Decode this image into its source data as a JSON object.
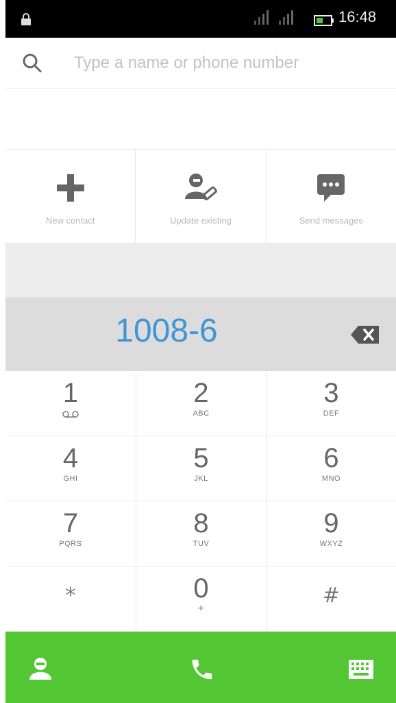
{
  "status_bar": {
    "time": "16:48",
    "icons": [
      "lock-icon",
      "signal-icon",
      "signal-icon",
      "battery-icon"
    ]
  },
  "search": {
    "placeholder": "Type a name or phone number",
    "value": ""
  },
  "actions": [
    {
      "label": "New contact",
      "icon": "plus-icon"
    },
    {
      "label": "Update existing",
      "icon": "contact-edit-icon"
    },
    {
      "label": "Send messages",
      "icon": "message-icon"
    }
  ],
  "display": {
    "number": "1008-6",
    "delete_icon": "backspace-icon"
  },
  "keypad": [
    {
      "digit": "1",
      "letters": ""
    },
    {
      "digit": "2",
      "letters": "ABC"
    },
    {
      "digit": "3",
      "letters": "DEF"
    },
    {
      "digit": "4",
      "letters": "GHI"
    },
    {
      "digit": "5",
      "letters": "JKL"
    },
    {
      "digit": "6",
      "letters": "MNO"
    },
    {
      "digit": "7",
      "letters": "PQRS"
    },
    {
      "digit": "8",
      "letters": "TUV"
    },
    {
      "digit": "9",
      "letters": "WXYZ"
    },
    {
      "digit": "*",
      "letters": ""
    },
    {
      "digit": "0",
      "letters": "+"
    },
    {
      "digit": "#",
      "letters": ""
    }
  ],
  "bottom_bar": {
    "icons": [
      "contacts-icon",
      "call-icon",
      "keyboard-icon"
    ]
  },
  "colors": {
    "accent_blue": "#3f95d6",
    "call_green": "#53c634",
    "icon_gray": "#666666"
  }
}
